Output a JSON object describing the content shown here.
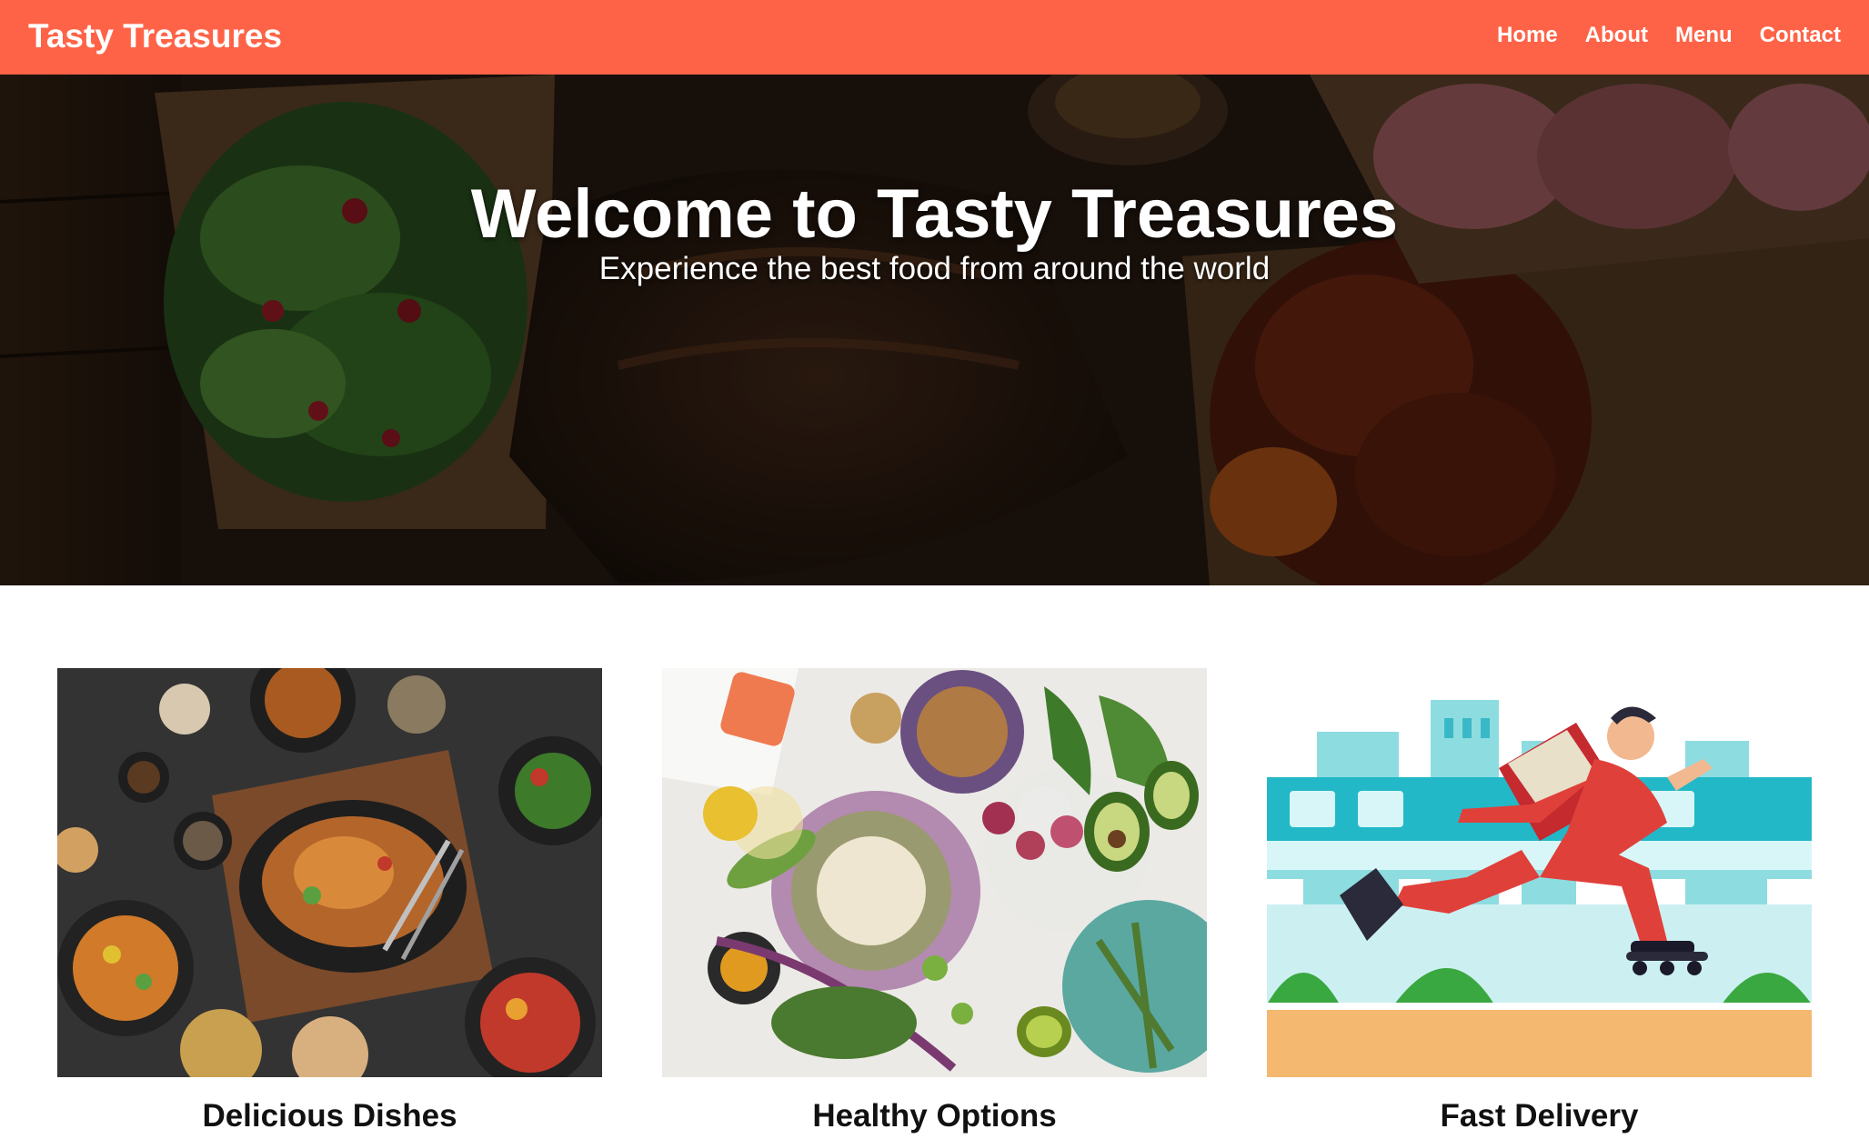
{
  "header": {
    "brand": "Tasty Treasures",
    "nav": [
      {
        "label": "Home"
      },
      {
        "label": "About"
      },
      {
        "label": "Menu"
      },
      {
        "label": "Contact"
      }
    ]
  },
  "hero": {
    "title": "Welcome to Tasty Treasures",
    "subtitle": "Experience the best food from around the world"
  },
  "features": [
    {
      "caption": "Delicious Dishes"
    },
    {
      "caption": "Healthy Options"
    },
    {
      "caption": "Fast Delivery"
    }
  ],
  "colors": {
    "accent": "#ff6347",
    "text": "#111111"
  }
}
